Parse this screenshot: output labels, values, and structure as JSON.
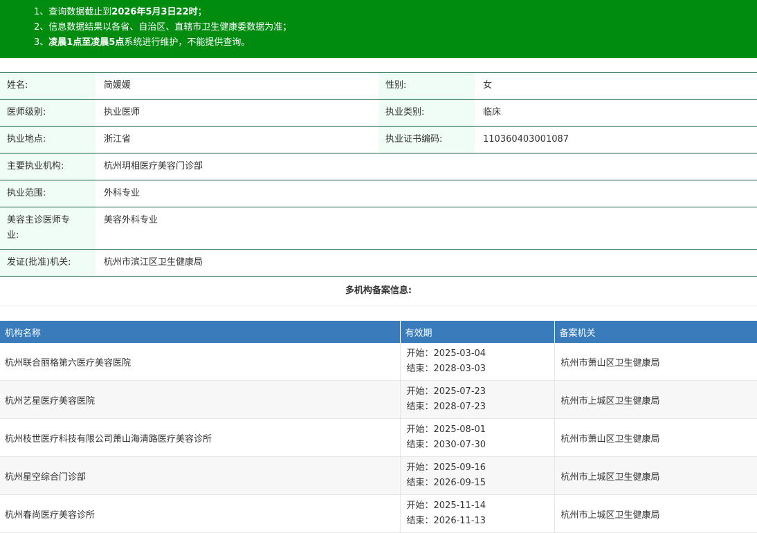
{
  "notice": {
    "line1_prefix": "1、查询数据截止到",
    "line1_bold": "2026年5月3日22时",
    "line1_suffix": "；",
    "line2": "2、信息数据结果以各省、自治区、直辖市卫生健康委数据为准；",
    "line3_prefix": "3、",
    "line3_bold": "凌晨1点至凌晨5点",
    "line3_suffix": "系统进行维护，不能提供查询。"
  },
  "doctor": {
    "name_label": "姓名:",
    "name": "简媛媛",
    "gender_label": "性别:",
    "gender": "女",
    "level_label": "医师级别:",
    "level": "执业医师",
    "category_label": "执业类别:",
    "category": "临床",
    "location_label": "执业地点:",
    "location": "浙江省",
    "cert_label": "执业证书编码:",
    "cert": "110360403001087",
    "institution_label": "主要执业机构:",
    "institution": "杭州玥相医疗美容门诊部",
    "scope_label": "执业范围:",
    "scope": "外科专业",
    "beauty_label": "美容主诊医师专业:",
    "beauty": "美容外科专业",
    "issuer_label": "发证(批准)机关:",
    "issuer": "杭州市滨江区卫生健康局"
  },
  "multi_section_title": "多机构备案信息:",
  "orgs_table": {
    "headers": [
      "机构名称",
      "有效期",
      "备案机关"
    ],
    "rows": [
      {
        "name": "杭州联合丽格第六医疗美容医院",
        "start": "开始：2025-03-04",
        "end": "结束：2028-03-03",
        "authority": "杭州市萧山区卫生健康局"
      },
      {
        "name": "杭州艺星医疗美容医院",
        "start": "开始：2025-07-23",
        "end": "结束：2028-07-23",
        "authority": "杭州市上城区卫生健康局"
      },
      {
        "name": "杭州枝世医疗科技有限公司萧山海清路医疗美容诊所",
        "start": "开始：2025-08-01",
        "end": "结束：2030-07-30",
        "authority": "杭州市萧山区卫生健康局"
      },
      {
        "name": "杭州星空综合门诊部",
        "start": "开始：2025-09-16",
        "end": "结束：2026-09-15",
        "authority": "杭州市上城区卫生健康局"
      },
      {
        "name": "杭州春尚医疗美容诊所",
        "start": "开始：2025-11-14",
        "end": "结束：2026-11-13",
        "authority": "杭州市上城区卫生健康局"
      }
    ]
  }
}
